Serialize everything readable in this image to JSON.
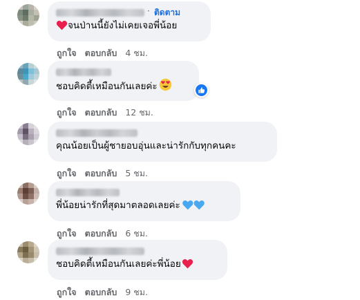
{
  "comments": [
    {
      "follow_label": "ติดตาม",
      "follow_separator": "·",
      "text": "จนป่านนี้ยังไม่เคยเจอพี่น้อย",
      "leading_icon": "red-heart-icon",
      "actions": {
        "like": "ถูกใจ",
        "reply": "ตอบกลับ",
        "time": "4 ชม."
      }
    },
    {
      "text": "ชอบคิดตี้เหมือนกันเลยค่ะ",
      "trailing_icon": "heart-eyes-emoji-icon",
      "reaction": "like-reaction-icon",
      "actions": {
        "like": "ถูกใจ",
        "reply": "ตอบกลับ",
        "time": "12 ชม."
      }
    },
    {
      "text": "คุณน้อยเป็นผู้ชายอบอุ่นและน่ารักกับทุกคนคะ",
      "actions": {
        "like": "ถูกใจ",
        "reply": "ตอบกลับ",
        "time": "5 ชม."
      }
    },
    {
      "text": "พี่น้อยน่ารักที่สุดมาตลอดเลยค่ะ",
      "trailing_icon": "blue-hearts-icon",
      "actions": {
        "like": "ถูกใจ",
        "reply": "ตอบกลับ",
        "time": "6 ชม."
      }
    },
    {
      "text": "ชอบคิดตี้เหมือนกันเลยค่ะพี่น้อย",
      "trailing_icon": "red-heart-icon",
      "actions": {
        "like": "ถูกใจ",
        "reply": "ตอบกลับ",
        "time": "9 ชม."
      }
    }
  ],
  "colors": {
    "bubble": "#f0f2f5",
    "text": "#050505",
    "meta": "#65676b",
    "follow": "#216fdb",
    "like_blue": "#1877f2",
    "heart_red": "#e8204d",
    "heart_blue": "#4aa8f0"
  }
}
